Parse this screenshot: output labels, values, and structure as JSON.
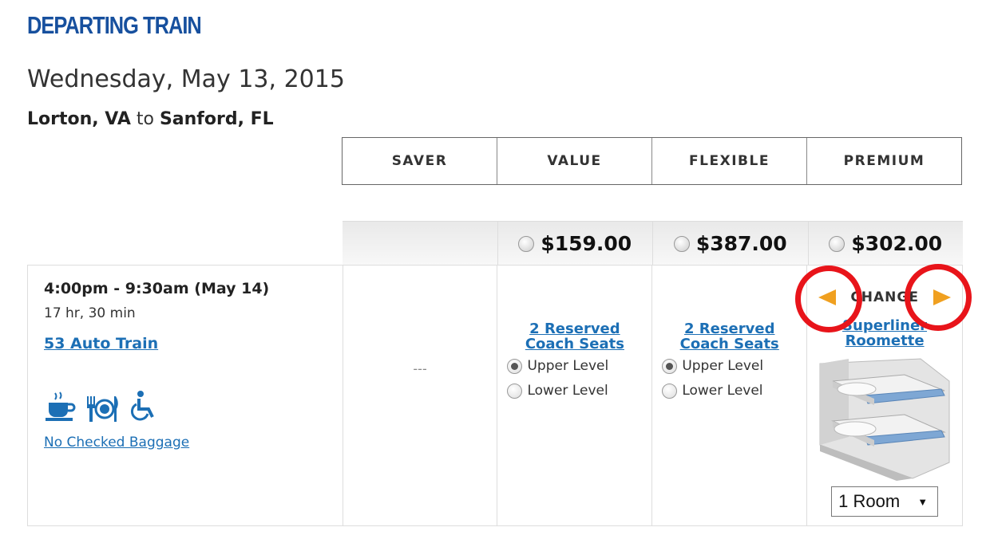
{
  "heading": "DEPARTING TRAIN",
  "date": "Wednesday, May 13, 2015",
  "route": {
    "from": "Lorton, VA",
    "to_word": "to",
    "to": "Sanford, FL"
  },
  "fare_classes": [
    "SAVER",
    "VALUE",
    "FLEXIBLE",
    "PREMIUM"
  ],
  "prices": {
    "value": "$159.00",
    "flexible": "$387.00",
    "premium": "$302.00"
  },
  "train": {
    "time": "4:00pm - 9:30am (May 14)",
    "duration": "17 hr, 30 min",
    "name": "53 Auto Train",
    "baggage": "No Checked Baggage",
    "amenity_icons": [
      "coffee-cup-icon",
      "dining-icon",
      "wheelchair-icon"
    ]
  },
  "saver": {
    "placeholder": "---"
  },
  "value": {
    "seat_link_line1": "2 Reserved",
    "seat_link_line2": "Coach Seats",
    "upper": "Upper Level",
    "lower": "Lower Level"
  },
  "flexible": {
    "seat_link_line1": "2 Reserved",
    "seat_link_line2": "Coach Seats",
    "upper": "Upper Level",
    "lower": "Lower Level"
  },
  "premium": {
    "change_label": "CHANGE",
    "room_line1": "Superliner",
    "room_line2": "Roomette",
    "rooms_selected": "1 Room"
  },
  "colors": {
    "heading": "#17509e",
    "link": "#1c6fb5",
    "arrow": "#f0a020",
    "highlight_circle": "#e8141a"
  }
}
